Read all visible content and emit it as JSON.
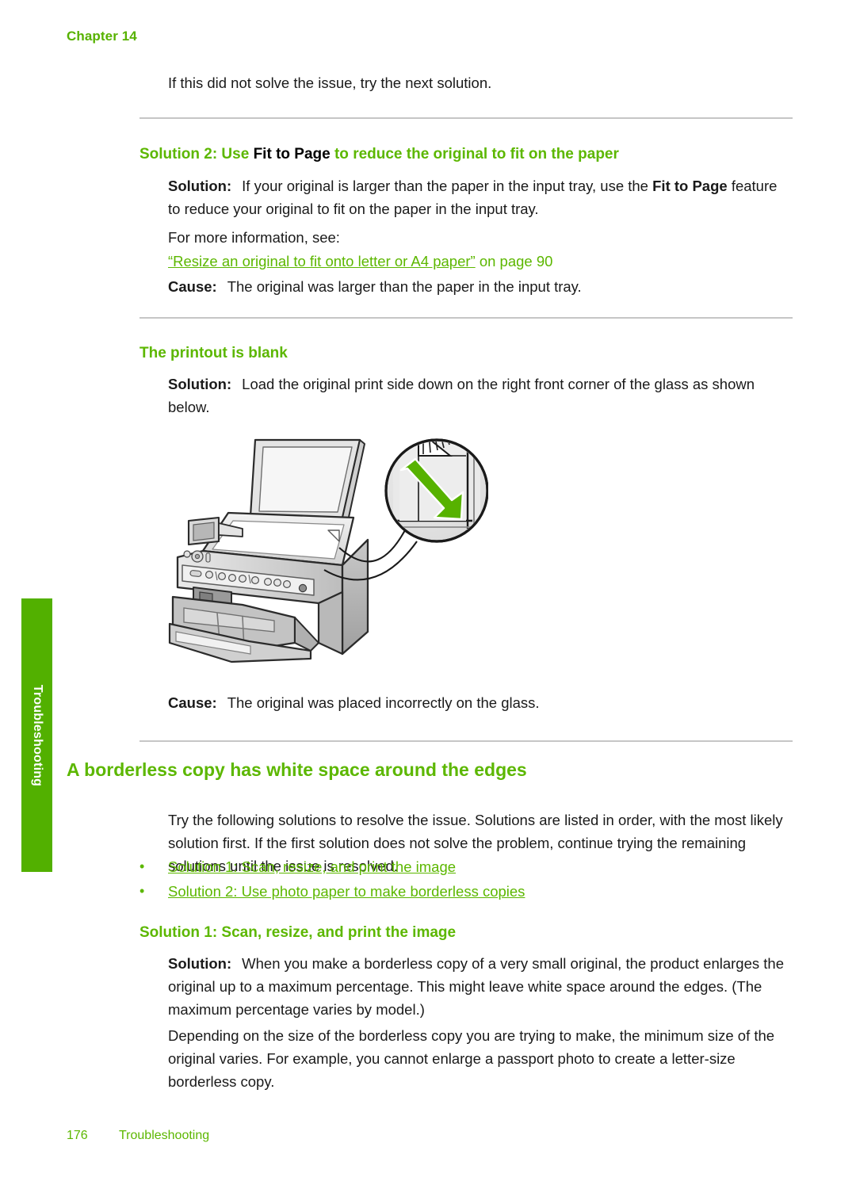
{
  "page": {
    "chapter_header": "Chapter 14",
    "side_tab_label": "Troubleshooting",
    "footer_page_number": "176",
    "footer_section": "Troubleshooting",
    "accent_green": "#5cb700",
    "tab_green": "#52b000",
    "rule_color": "#c6c6c6"
  },
  "intro": {
    "text": "If this did not solve the issue, try the next solution."
  },
  "solution2_fit_to_page": {
    "heading_part1": "Solution 2: Use ",
    "heading_bold_black": "Fit to Page",
    "heading_part2": " to reduce the original to fit on the paper",
    "solution_label": "Solution:",
    "solution_text_1": "If your original is larger than the paper in the input tray, use the ",
    "solution_bold_1": "Fit to Page",
    "solution_text_2": " feature to reduce your original to fit on the paper in the input tray.",
    "more_info": "For more information, see:",
    "xref_link": "“Resize an original to fit onto letter or A4 paper”",
    "xref_suffix": " on page 90",
    "cause_label": "Cause:",
    "cause_text": "The original was larger than the paper in the input tray."
  },
  "printout_blank": {
    "heading": "The printout is blank",
    "solution_label": "Solution:",
    "solution_text": "Load the original print side down on the right front corner of the glass as shown below.",
    "illustration_name": "all-in-one-printer-load-original-illustration",
    "cause_label": "Cause:",
    "cause_text": "The original was placed incorrectly on the glass."
  },
  "borderless_section": {
    "heading": "A borderless copy has white space around the edges",
    "intro": "Try the following solutions to resolve the issue. Solutions are listed in order, with the most likely solution first. If the first solution does not solve the problem, continue trying the remaining solutions until the issue is resolved.",
    "bullets": [
      {
        "bullet": "•",
        "label": "Solution 1: Scan, resize, and print the image"
      },
      {
        "bullet": "•",
        "label": "Solution 2: Use photo paper to make borderless copies"
      }
    ]
  },
  "solution1_scan_resize": {
    "heading": "Solution 1: Scan, resize, and print the image",
    "solution_label": "Solution:",
    "solution_text": "When you make a borderless copy of a very small original, the product enlarges the original up to a maximum percentage. This might leave white space around the edges. (The maximum percentage varies by model.)",
    "paragraph_2": "Depending on the size of the borderless copy you are trying to make, the minimum size of the original varies. For example, you cannot enlarge a passport photo to create a letter-size borderless copy."
  }
}
